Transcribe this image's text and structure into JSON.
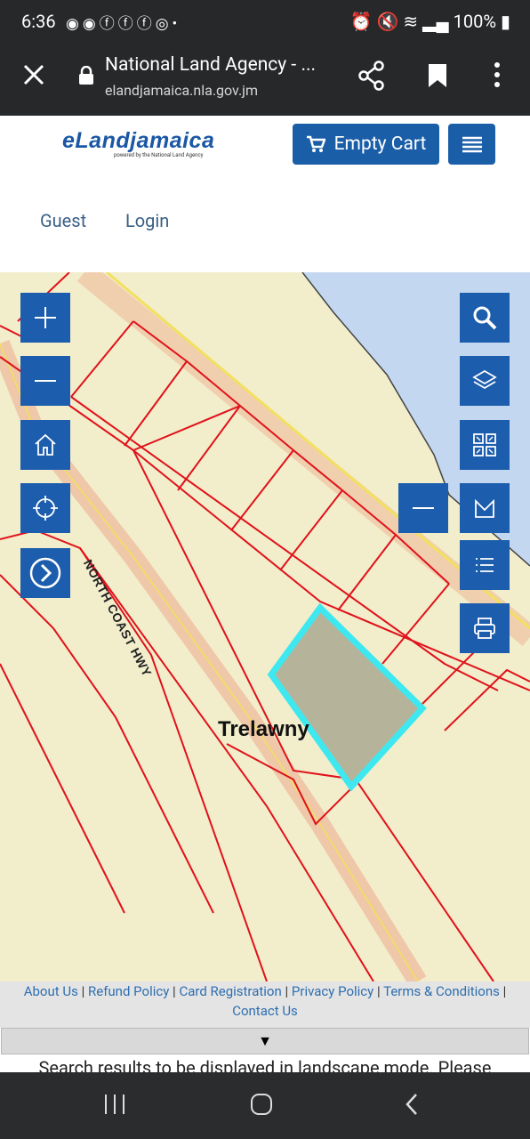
{
  "status_bar": {
    "time": "6:36",
    "left_icons": [
      "messenger-icon",
      "messenger-icon",
      "facebook-icon",
      "facebook-icon",
      "facebook-icon",
      "instagram-icon",
      "dot-icon"
    ],
    "battery": "100%"
  },
  "browser": {
    "page_title": "National Land Agency - ...",
    "domain": "elandjamaica.nla.gov.jm"
  },
  "site": {
    "logo_text": "eLandjamaica",
    "logo_tagline": "powered by the National Land Agency",
    "cart_label": "Empty Cart",
    "nav": {
      "guest": "Guest",
      "login": "Login"
    }
  },
  "map": {
    "parish_label": "Trelawny",
    "road_label": "NORTH COAST HWY",
    "colors": {
      "land": "#f2edcb",
      "sea": "#c3d8f0",
      "parcel_lines": "#e0121b",
      "selected_fill": "#b5b49b",
      "selected_outline": "#3ee8f0",
      "button": "#1c5dad"
    },
    "left_controls": [
      "zoom-in-icon",
      "zoom-out-icon",
      "home-icon",
      "locate-icon",
      "expand-panel-icon"
    ],
    "right_controls": [
      "search-icon",
      "layers-icon",
      "qr-icon",
      "collapse-icon",
      "measure-icon",
      "list-icon",
      "print-icon"
    ]
  },
  "footer": {
    "links": [
      "About Us",
      "Refund Policy",
      "Card Registration",
      "Privacy Policy",
      "Terms & Conditions",
      "Contact Us"
    ],
    "separator": "|",
    "toggle_glyph": "▼",
    "notice": "Search results to be displayed in landscape mode. Please"
  }
}
